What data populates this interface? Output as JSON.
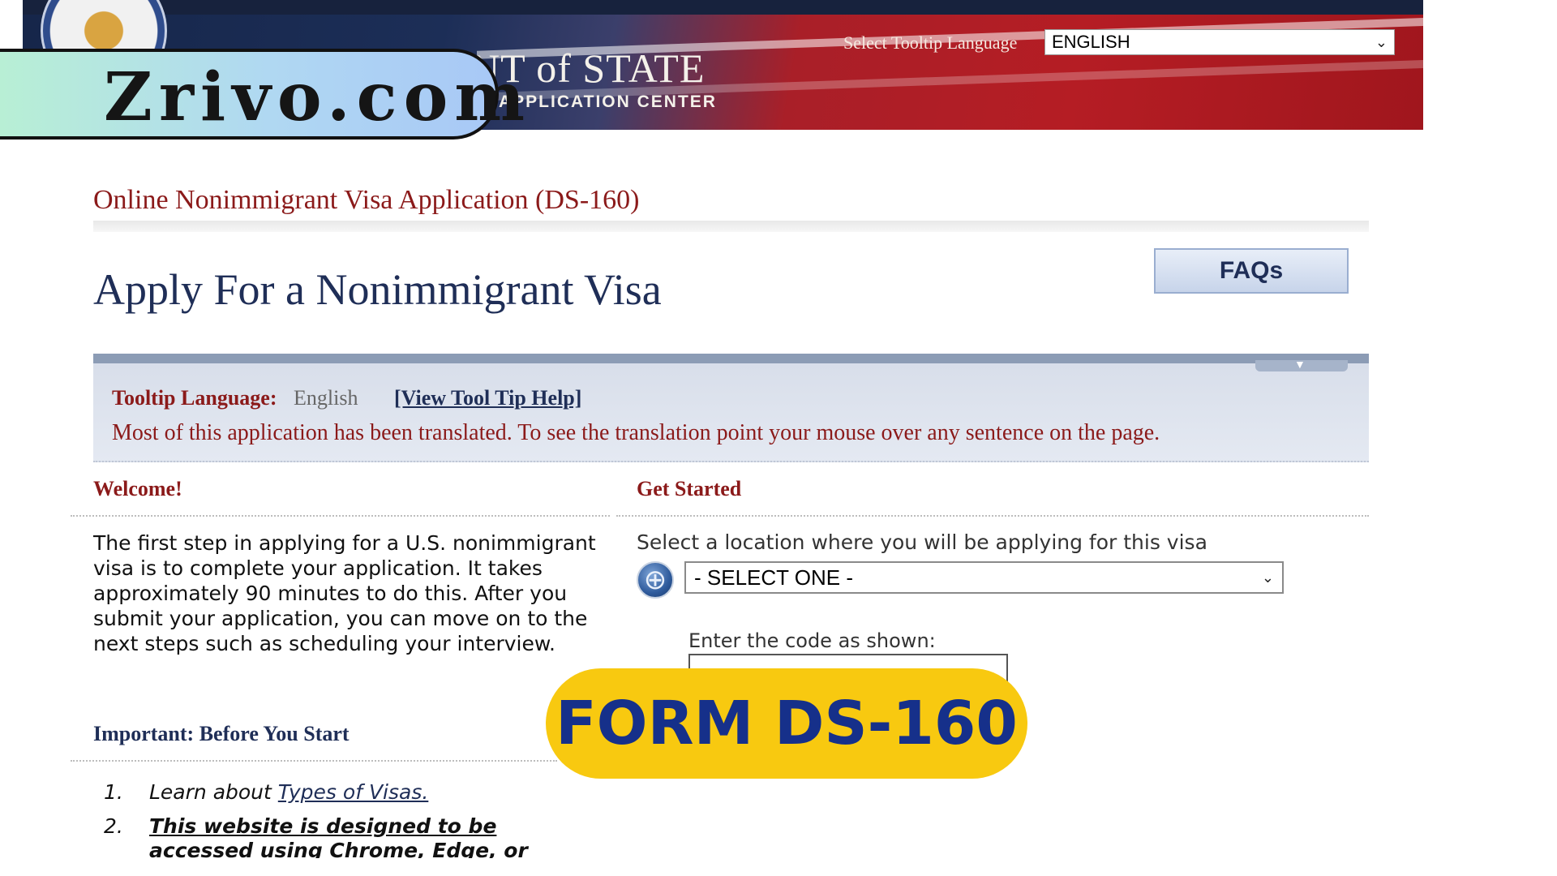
{
  "header": {
    "agency_title": "NT of STATE",
    "agency_subtitle": "APPLICATION CENTER",
    "tooltip_language_label": "Select Tooltip Language",
    "tooltip_language_value": "ENGLISH"
  },
  "watermark": {
    "text": "Zrivo.com"
  },
  "page": {
    "app_title": "Online Nonimmigrant Visa Application (DS-160)",
    "heading": "Apply For a Nonimmigrant Visa",
    "faq_label": "FAQs"
  },
  "tooltip_panel": {
    "label": "Tooltip Language:",
    "value": "English",
    "help_link": "[View Tool Tip Help]",
    "note": "Most of this application has been translated. To see the translation point your mouse over any sentence on the page."
  },
  "welcome": {
    "heading": "Welcome!",
    "body": "The first step in applying for a U.S. nonimmigrant visa is to complete your application. It takes approximately 90 minutes to do this. After you submit your application, you can move on to the next steps such as scheduling your interview."
  },
  "get_started": {
    "heading": "Get Started",
    "location_label": "Select a location where you will be applying for this visa",
    "location_value": "- SELECT ONE -",
    "code_label": "Enter the code as shown:"
  },
  "important": {
    "heading": "Important: Before You Start",
    "steps": [
      {
        "num": "1.",
        "prefix": "Learn about ",
        "link": "Types of Visas."
      },
      {
        "num": "2.",
        "line1": "This website is designed to be",
        "line2": "accessed using Chrome, Edge, or"
      }
    ]
  },
  "badge": {
    "text": "FORM DS-160"
  },
  "icons": {
    "dropdown": "chevron-down-icon",
    "globe": "globe-icon",
    "seal": "department-seal-icon"
  },
  "colors": {
    "accent_red": "#8b1a1a",
    "navy": "#1f2e57",
    "badge_yellow": "#f8c910",
    "badge_text": "#16308a"
  }
}
